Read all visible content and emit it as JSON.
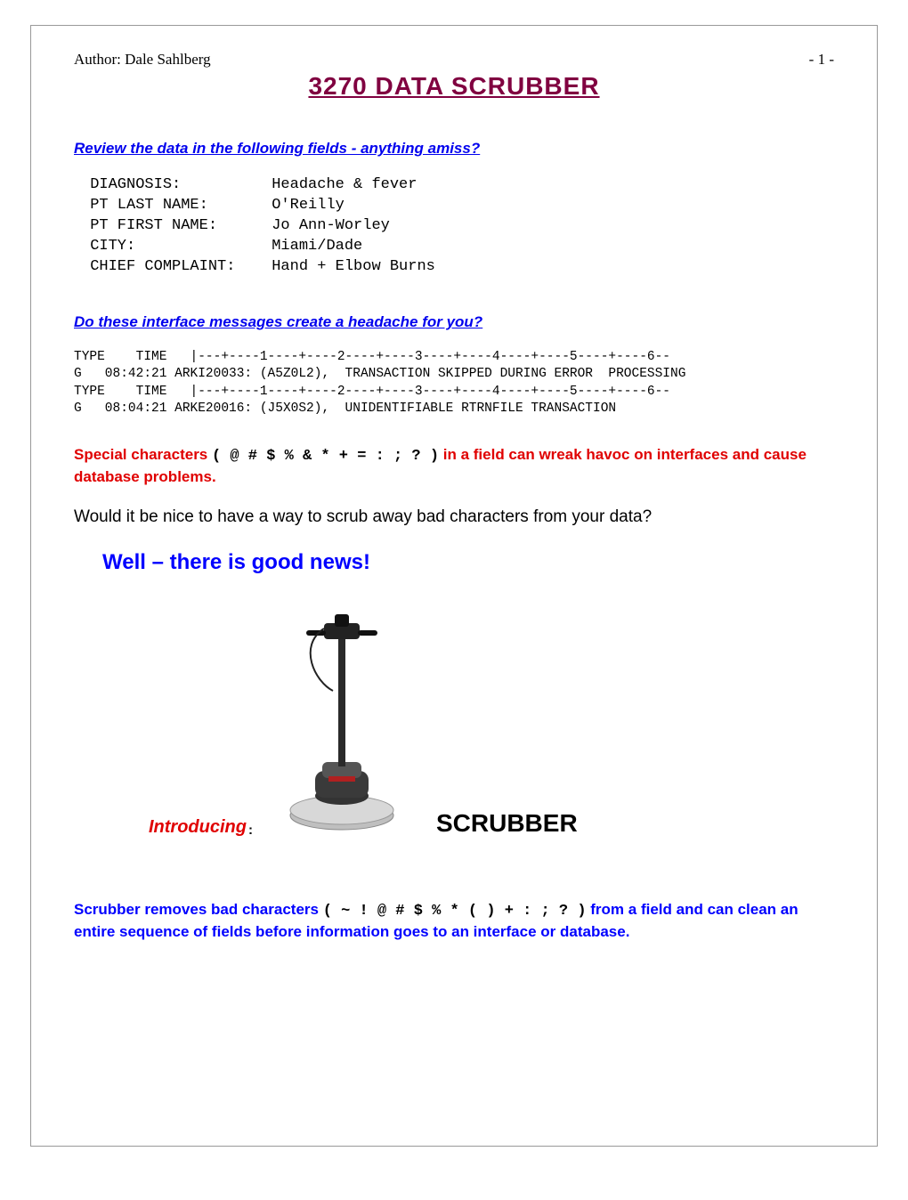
{
  "header": {
    "author_line": "Author:  Dale Sahlberg",
    "page_num": "- 1 -"
  },
  "title": "3270   DATA   SCRUBBER",
  "section1": {
    "heading": "Review the data in the following fields - anything amiss?",
    "fields_block": " DIAGNOSIS:          Headache & fever\n PT LAST NAME:       O'Reilly\n PT FIRST NAME:      Jo Ann-Worley\n CITY:               Miami/Dade\n CHIEF COMPLAINT:    Hand + Elbow Burns"
  },
  "section2": {
    "heading": "Do these interface messages create a headache for you?",
    "log_block": "TYPE    TIME   |---+----1----+----2----+----3----+----4----+----5----+----6--\nG   08:42:21 ARKI20033: (A5Z0L2),  TRANSACTION SKIPPED DURING ERROR  PROCESSING\nTYPE    TIME   |---+----1----+----2----+----3----+----4----+----5----+----6--\nG   08:04:21 ARKE20016: (J5X0S2),  UNIDENTIFIABLE RTRNFILE TRANSACTION"
  },
  "warning": {
    "pre": "Special characters ",
    "chars": "( @ # $ % & * + = : ; ? )",
    "post": "   in a field can wreak havoc on interfaces and cause database problems."
  },
  "question": "Would it be nice to have a way to scrub away bad characters from your data?",
  "good_news": "Well – there is good news!",
  "intro": {
    "label": "Introducing",
    "colon": " :",
    "name": "SCRUBBER"
  },
  "summary": {
    "pre": "Scrubber removes bad characters ",
    "chars": "( ~  !  @  #  $  %  *  (  )  +  :  ;  ?  )",
    "post": "  from a field and can clean an entire sequence of fields before information goes to an interface or database."
  }
}
